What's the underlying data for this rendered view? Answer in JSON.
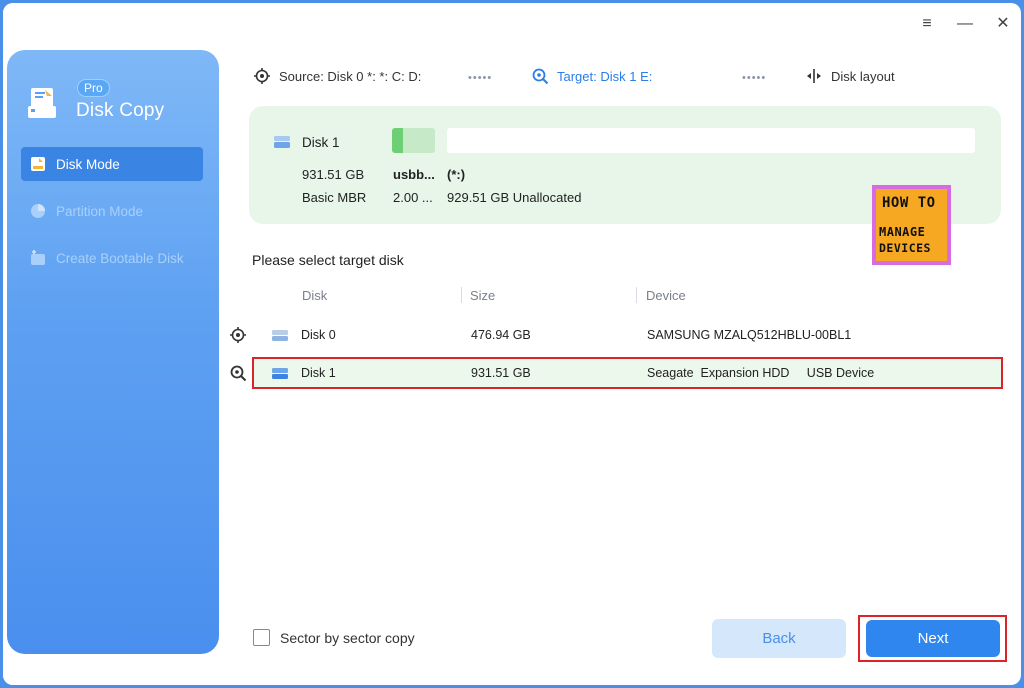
{
  "brand": {
    "badge": "Pro",
    "title": "Disk Copy"
  },
  "sidebar": {
    "items": [
      {
        "label": "Disk Mode",
        "icon": "disk-mode-icon",
        "state": "active"
      },
      {
        "label": "Partition Mode",
        "icon": "pie-chart-icon",
        "state": "disabled"
      },
      {
        "label": "Create Bootable Disk",
        "icon": "bootable-disk-icon",
        "state": "disabled"
      }
    ]
  },
  "window_controls": {
    "menu": "≡",
    "minimize": "—",
    "close": "✕"
  },
  "steps": {
    "source": "Source: Disk 0 *: *: C: D:",
    "target": "Target: Disk 1 E:",
    "layout": "Disk layout",
    "dots": "•••••"
  },
  "summary": {
    "disk_name": "Disk 1",
    "size": "931.51 GB",
    "partition_style": "Basic MBR",
    "partition_label": "usbb...",
    "partition_size": "2.00 ...",
    "volume": "(*:)",
    "unallocated": "929.51 GB Unallocated",
    "partition_fill_fraction": 0.25
  },
  "watermark": {
    "line1": "HOW TO",
    "line2": "MANAGE",
    "line3": "DEVICES"
  },
  "table": {
    "title": "Please select target disk",
    "columns": [
      "Disk",
      "Size",
      "Device"
    ],
    "rows": [
      {
        "disk": "Disk 0",
        "size": "476.94 GB",
        "device": "SAMSUNG MZALQ512HBLU-00BL1",
        "role_icon": "source-crosshair-icon",
        "selected": false
      },
      {
        "disk": "Disk 1",
        "size": "931.51 GB",
        "device": "Seagate  Expansion HDD     USB Device",
        "role_icon": "target-search-icon",
        "selected": true
      }
    ]
  },
  "footer": {
    "sector_copy_label": "Sector by sector copy",
    "back_label": "Back",
    "next_label": "Next"
  },
  "colors": {
    "accent": "#2f86ee",
    "sidebar_top": "#7fb8f7",
    "sidebar_bottom": "#4a8fee",
    "summary_bg": "#e7f6e9",
    "highlight": "#d9252a"
  }
}
